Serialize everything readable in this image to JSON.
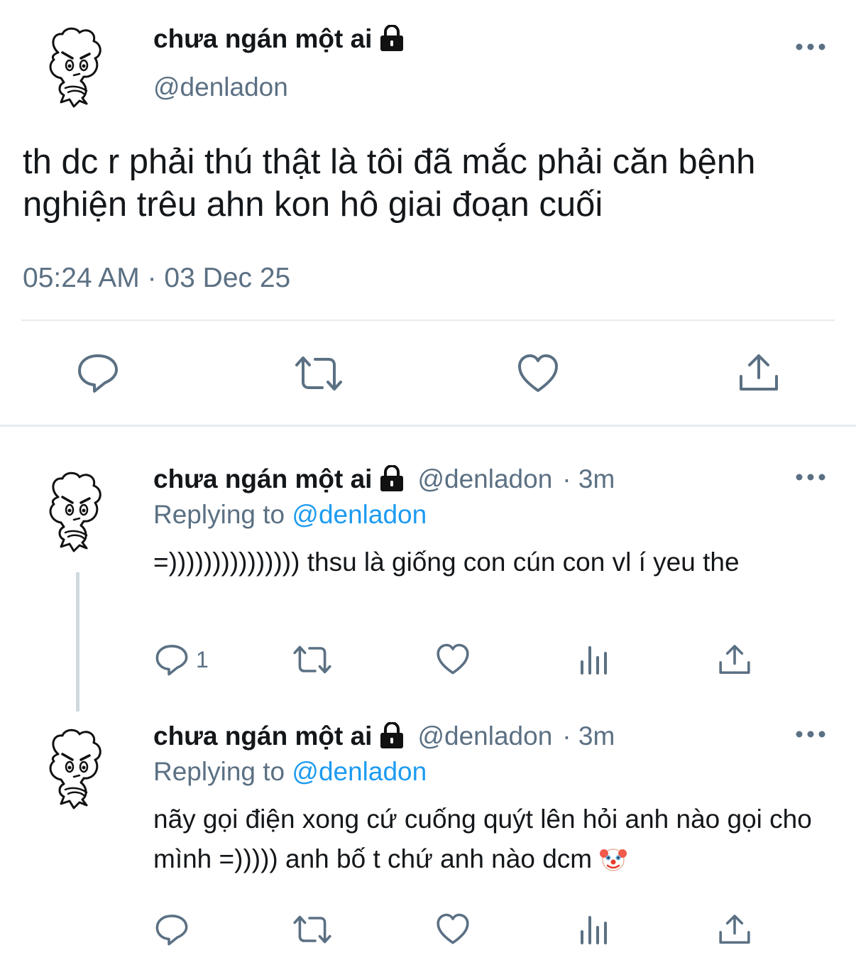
{
  "main_tweet": {
    "display_name": "chưa ngán một ai",
    "handle": "@denladon",
    "text": "th dc r phải thú thật là tôi đã mắc phải căn bệnh nghiện trêu ahn kon hô giai đoạn cuối",
    "timestamp": "05:24 AM · 03 Dec 25",
    "actions": [
      "reply",
      "retweet",
      "like",
      "share"
    ]
  },
  "replies": [
    {
      "display_name": "chưa ngán một ai",
      "handle": "@denladon",
      "meta": "· 3m",
      "replying_prefix": "Replying to",
      "replying_to": "@denladon",
      "text": "=))))))))))))))) thsu là giống con cún con vl í yeu the",
      "reply_count": "1"
    },
    {
      "display_name": "chưa ngán một ai",
      "handle": "@denladon",
      "meta": "· 3m",
      "replying_prefix": "Replying to",
      "replying_to": "@denladon",
      "text": "nãy gọi điện xong cứ cuống quýt lên hỏi anh nào gọi cho mình =))))) anh bố t chứ anh nào dcm",
      "emoji": "clown-face"
    }
  ],
  "colors": {
    "text": "#14171a",
    "secondary": "#5b7083",
    "link": "#1d9bf0",
    "divider": "#e6ecf0",
    "icon": "#5b7083"
  }
}
